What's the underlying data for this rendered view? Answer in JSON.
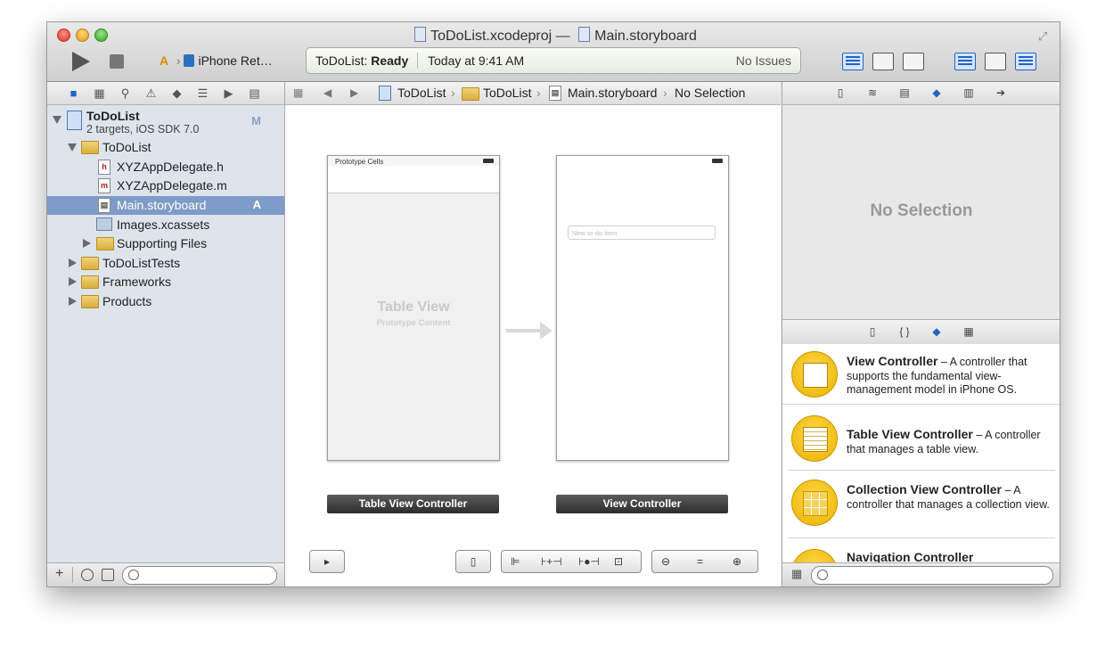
{
  "window": {
    "title_project": "ToDoList.xcodeproj",
    "title_separator": "—",
    "title_file": "Main.storyboard"
  },
  "toolbar": {
    "scheme": "iPhone Ret…",
    "status_prefix": "ToDoList:",
    "status_state": "Ready",
    "status_time": "Today at 9:41 AM",
    "issues": "No Issues"
  },
  "navigator": {
    "project_name": "ToDoList",
    "project_subtitle": "2 targets, iOS SDK 7.0",
    "project_badge": "M",
    "items": [
      {
        "label": "ToDoList"
      },
      {
        "label": "XYZAppDelegate.h",
        "glyph": "h"
      },
      {
        "label": "XYZAppDelegate.m",
        "glyph": "m"
      },
      {
        "label": "Main.storyboard",
        "badge": "A"
      },
      {
        "label": "Images.xcassets"
      },
      {
        "label": "Supporting Files"
      },
      {
        "label": "ToDoListTests"
      },
      {
        "label": "Frameworks"
      },
      {
        "label": "Products"
      }
    ]
  },
  "jump_bar": {
    "crumbs": [
      "ToDoList",
      "ToDoList",
      "Main.storyboard",
      "No Selection"
    ]
  },
  "canvas": {
    "table_scene": {
      "header": "Prototype Cells",
      "title": "Table View",
      "subtitle": "Prototype Content",
      "label": "Table View Controller"
    },
    "view_scene": {
      "placeholder": "New to-do item",
      "label": "View Controller"
    }
  },
  "inspector": {
    "empty_text": "No Selection"
  },
  "library": {
    "items": [
      {
        "name": "View Controller",
        "desc": " – A controller that supports the fundamental view-management model in iPhone OS."
      },
      {
        "name": "Table View Controller",
        "desc": " – A controller that manages a table view."
      },
      {
        "name": "Collection View Controller",
        "desc": " – A controller that manages a collection view."
      },
      {
        "name": "Navigation Controller",
        "desc": ""
      }
    ]
  },
  "colors": {
    "selection": "#7f9bc8",
    "accent": "#1f64c7",
    "library_icon": "#f5c400"
  }
}
